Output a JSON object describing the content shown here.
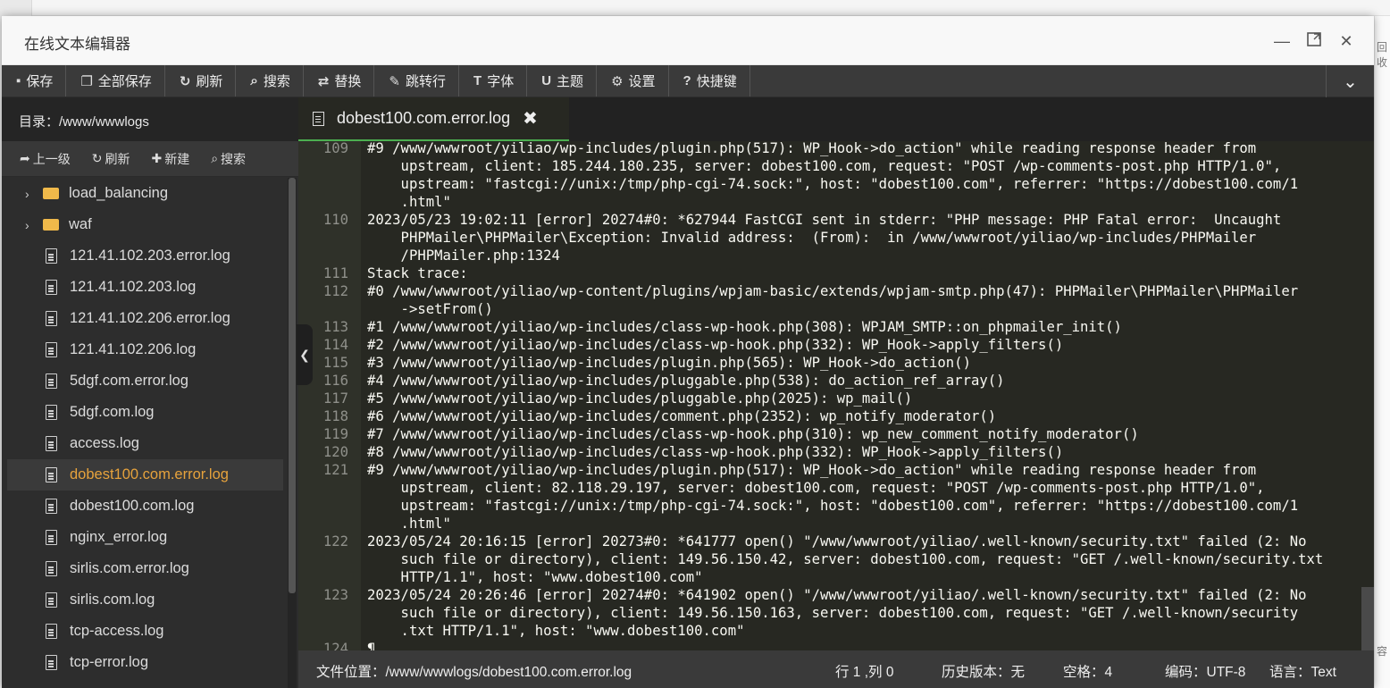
{
  "window": {
    "title": "在线文本编辑器"
  },
  "toolbar": {
    "items": [
      {
        "label": "保存",
        "icon": "floppy-icon"
      },
      {
        "label": "全部保存",
        "icon": "files-icon"
      },
      {
        "label": "刷新",
        "icon": "refresh-icon"
      },
      {
        "label": "搜索",
        "icon": "search-icon"
      },
      {
        "label": "替换",
        "icon": "replace-icon"
      },
      {
        "label": "跳转行",
        "icon": "pin-icon"
      },
      {
        "label": "字体",
        "icon": "text-icon"
      },
      {
        "label": "主题",
        "icon": "magnet-icon"
      },
      {
        "label": "设置",
        "icon": "gear-icon"
      },
      {
        "label": "快捷键",
        "icon": "question-icon"
      }
    ]
  },
  "sidebar": {
    "path": "目录：/www/wwwlogs",
    "actions": [
      {
        "label": "上一级",
        "icon": "arrow-up-icon"
      },
      {
        "label": "刷新",
        "icon": "refresh-icon"
      },
      {
        "label": "新建",
        "icon": "plus-icon"
      },
      {
        "label": "搜索",
        "icon": "search-icon"
      }
    ],
    "tree": [
      {
        "label": "load_balancing",
        "type": "folder"
      },
      {
        "label": "waf",
        "type": "folder"
      },
      {
        "label": "121.41.102.203.error.log",
        "type": "file"
      },
      {
        "label": "121.41.102.203.log",
        "type": "file"
      },
      {
        "label": "121.41.102.206.error.log",
        "type": "file"
      },
      {
        "label": "121.41.102.206.log",
        "type": "file"
      },
      {
        "label": "5dgf.com.error.log",
        "type": "file"
      },
      {
        "label": "5dgf.com.log",
        "type": "file"
      },
      {
        "label": "access.log",
        "type": "file"
      },
      {
        "label": "dobest100.com.error.log",
        "type": "file",
        "active": true
      },
      {
        "label": "dobest100.com.log",
        "type": "file"
      },
      {
        "label": "nginx_error.log",
        "type": "file"
      },
      {
        "label": "sirlis.com.error.log",
        "type": "file"
      },
      {
        "label": "sirlis.com.log",
        "type": "file"
      },
      {
        "label": "tcp-access.log",
        "type": "file"
      },
      {
        "label": "tcp-error.log",
        "type": "file"
      }
    ]
  },
  "editor": {
    "tab": {
      "label": "dobest100.com.error.log"
    },
    "lines": [
      {
        "n": "109",
        "parts": [
          "#9 /www/wwwroot/yiliao/wp-includes/plugin.php(517): WP_Hook->do_action\" while reading response header from",
          "    upstream, client: 185.244.180.235, server: dobest100.com, request: \"POST /wp-comments-post.php HTTP/1.0\",",
          "    upstream: \"fastcgi://unix:/tmp/php-cgi-74.sock:\", host: \"dobest100.com\", referrer: \"https://dobest100.com/1",
          "    .html\""
        ]
      },
      {
        "n": "110",
        "parts": [
          "2023/05/23 19:02:11 [error] 20274#0: *627944 FastCGI sent in stderr: \"PHP message: PHP Fatal error:  Uncaught",
          "    PHPMailer\\PHPMailer\\Exception: Invalid address:  (From):  in /www/wwwroot/yiliao/wp-includes/PHPMailer",
          "    /PHPMailer.php:1324"
        ]
      },
      {
        "n": "111",
        "parts": [
          "Stack trace:"
        ]
      },
      {
        "n": "112",
        "parts": [
          "#0 /www/wwwroot/yiliao/wp-content/plugins/wpjam-basic/extends/wpjam-smtp.php(47): PHPMailer\\PHPMailer\\PHPMailer",
          "    ->setFrom()"
        ]
      },
      {
        "n": "113",
        "parts": [
          "#1 /www/wwwroot/yiliao/wp-includes/class-wp-hook.php(308): WPJAM_SMTP::on_phpmailer_init()"
        ]
      },
      {
        "n": "114",
        "parts": [
          "#2 /www/wwwroot/yiliao/wp-includes/class-wp-hook.php(332): WP_Hook->apply_filters()"
        ]
      },
      {
        "n": "115",
        "parts": [
          "#3 /www/wwwroot/yiliao/wp-includes/plugin.php(565): WP_Hook->do_action()"
        ]
      },
      {
        "n": "116",
        "parts": [
          "#4 /www/wwwroot/yiliao/wp-includes/pluggable.php(538): do_action_ref_array()"
        ]
      },
      {
        "n": "117",
        "parts": [
          "#5 /www/wwwroot/yiliao/wp-includes/pluggable.php(2025): wp_mail()"
        ]
      },
      {
        "n": "118",
        "parts": [
          "#6 /www/wwwroot/yiliao/wp-includes/comment.php(2352): wp_notify_moderator()"
        ]
      },
      {
        "n": "119",
        "parts": [
          "#7 /www/wwwroot/yiliao/wp-includes/class-wp-hook.php(310): wp_new_comment_notify_moderator()"
        ]
      },
      {
        "n": "120",
        "parts": [
          "#8 /www/wwwroot/yiliao/wp-includes/class-wp-hook.php(332): WP_Hook->apply_filters()"
        ]
      },
      {
        "n": "121",
        "parts": [
          "#9 /www/wwwroot/yiliao/wp-includes/plugin.php(517): WP_Hook->do_action\" while reading response header from",
          "    upstream, client: 82.118.29.197, server: dobest100.com, request: \"POST /wp-comments-post.php HTTP/1.0\",",
          "    upstream: \"fastcgi://unix:/tmp/php-cgi-74.sock:\", host: \"dobest100.com\", referrer: \"https://dobest100.com/1",
          "    .html\""
        ]
      },
      {
        "n": "122",
        "parts": [
          "2023/05/24 20:16:15 [error] 20273#0: *641777 open() \"/www/wwwroot/yiliao/.well-known/security.txt\" failed (2: No",
          "    such file or directory), client: 149.56.150.42, server: dobest100.com, request: \"GET /.well-known/security.txt",
          "    HTTP/1.1\", host: \"www.dobest100.com\""
        ]
      },
      {
        "n": "123",
        "parts": [
          "2023/05/24 20:26:46 [error] 20274#0: *641902 open() \"/www/wwwroot/yiliao/.well-known/security.txt\" failed (2: No",
          "    such file or directory), client: 149.56.150.163, server: dobest100.com, request: \"GET /.well-known/security",
          "    .txt HTTP/1.1\", host: \"www.dobest100.com\""
        ]
      },
      {
        "n": "124",
        "parts": [
          "¶"
        ]
      }
    ]
  },
  "status": {
    "file": "文件位置：/www/wwwlogs/dobest100.com.error.log",
    "cursor": "行 1 ,列 0",
    "history": "历史版本：无",
    "spaces": "空格：4",
    "encoding": "编码：UTF-8",
    "language": "语言：Text"
  },
  "background": {
    "right_text_1": "回收",
    "right_text_2": "容"
  },
  "colors": {
    "accent_active_file": "#e6a23c",
    "tab_underline": "#4caf50",
    "folder": "#f0b94a"
  }
}
